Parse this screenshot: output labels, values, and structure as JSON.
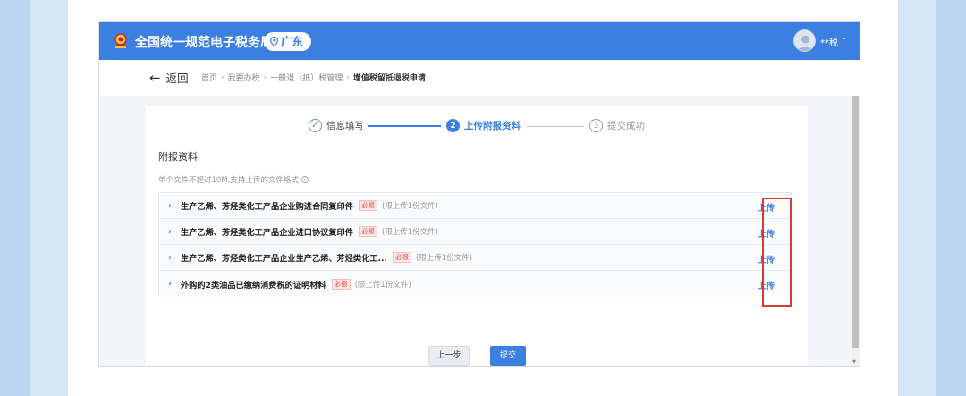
{
  "app": {
    "title": "全国统一规范电子税务局",
    "region": "广东",
    "user_name": "**税",
    "colors": {
      "primary": "#3b7fe0",
      "required": "#e0514a",
      "highlight": "#d43b35"
    }
  },
  "nav": {
    "back_label": "返回",
    "breadcrumbs": [
      "首页",
      "我要办税",
      "一般退（抵）税管理",
      "增值税留抵退税申请"
    ]
  },
  "steps": [
    {
      "index": "✓",
      "label": "信息填写",
      "state": "done"
    },
    {
      "index": "2",
      "label": "上传附报资料",
      "state": "active"
    },
    {
      "index": "3",
      "label": "提交成功",
      "state": "pending"
    }
  ],
  "attachments": {
    "title": "附报资料",
    "hint": "单个文件不超过10M,支持上传的文件格式",
    "required_badge": "必报",
    "upload_label": "上传",
    "rows": [
      {
        "name": "生产乙烯、芳烃类化工产品企业购进合同复印件",
        "limit": "(限上传1份文件)"
      },
      {
        "name": "生产乙烯、芳烃类化工产品企业进口协议复印件",
        "limit": "(限上传1份文件)"
      },
      {
        "name": "生产乙烯、芳烃类化工产品企业生产乙烯、芳烃类化工...",
        "limit": "(限上传1份文件)"
      },
      {
        "name": "外购的2类油品已缴纳消费税的证明材料",
        "limit": "(限上传1份文件)"
      }
    ]
  },
  "actions": {
    "prev_label": "上一步",
    "submit_label": "提交"
  },
  "icons": {
    "logo": "tax-emblem-icon",
    "region": "location-pin-icon",
    "back": "arrow-left-icon",
    "expand": "chevron-right-icon",
    "info": "info-icon",
    "user": "avatar-icon"
  }
}
